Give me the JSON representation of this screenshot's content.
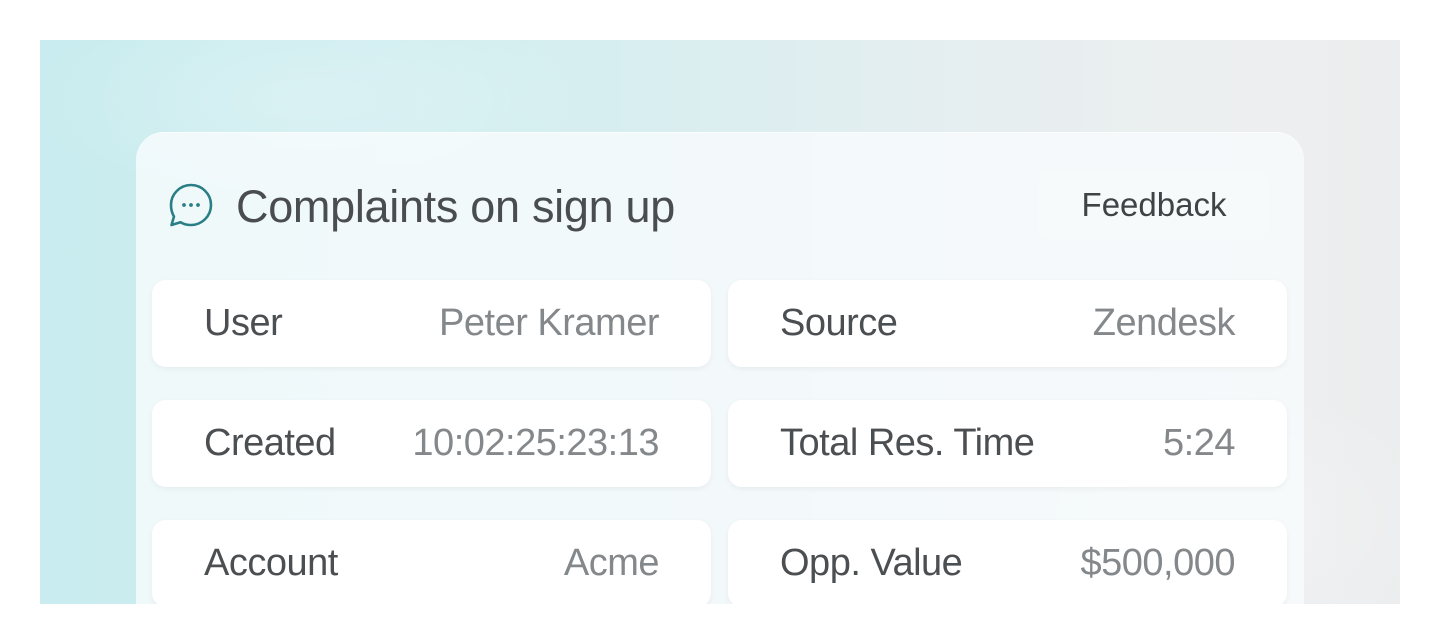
{
  "card": {
    "title": "Complaints on sign up",
    "icon": "chat-bubble-icon",
    "tag_label": "Feedback"
  },
  "fields": {
    "user": {
      "label": "User",
      "value": "Peter Kramer"
    },
    "source": {
      "label": "Source",
      "value": "Zendesk"
    },
    "created": {
      "label": "Created",
      "value": "10:02:25:23:13"
    },
    "total_res_time": {
      "label": "Total Res. Time",
      "value": "5:24"
    },
    "account": {
      "label": "Account",
      "value": "Acme"
    },
    "opp_value": {
      "label": "Opp. Value",
      "value": "$500,000"
    }
  },
  "colors": {
    "accent": "#2a7f86",
    "title_text": "#4a4d50",
    "value_text": "#85888b"
  }
}
